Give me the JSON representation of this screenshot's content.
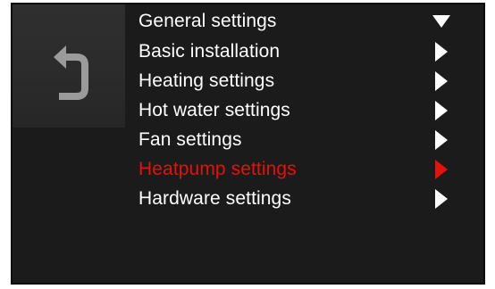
{
  "colors": {
    "screen_bg": "#1b1b1b",
    "back_panel_bg": "#2d2d2d",
    "text": "#ffffff",
    "active": "#e3120b",
    "back_icon": "#9b9b9b"
  },
  "back_button": {
    "icon": "undo-arrow-icon"
  },
  "menu": {
    "items": [
      {
        "label": "General settings",
        "arrow": "triangle-down-icon",
        "state": "expanded"
      },
      {
        "label": "Basic installation",
        "arrow": "triangle-right-icon",
        "state": "collapsed"
      },
      {
        "label": "Heating settings",
        "arrow": "triangle-right-icon",
        "state": "collapsed"
      },
      {
        "label": "Hot water settings",
        "arrow": "triangle-right-icon",
        "state": "collapsed"
      },
      {
        "label": "Fan settings",
        "arrow": "triangle-right-icon",
        "state": "collapsed"
      },
      {
        "label": "Heatpump settings",
        "arrow": "triangle-right-icon",
        "state": "selected"
      },
      {
        "label": "Hardware settings",
        "arrow": "triangle-right-icon",
        "state": "collapsed"
      }
    ]
  }
}
